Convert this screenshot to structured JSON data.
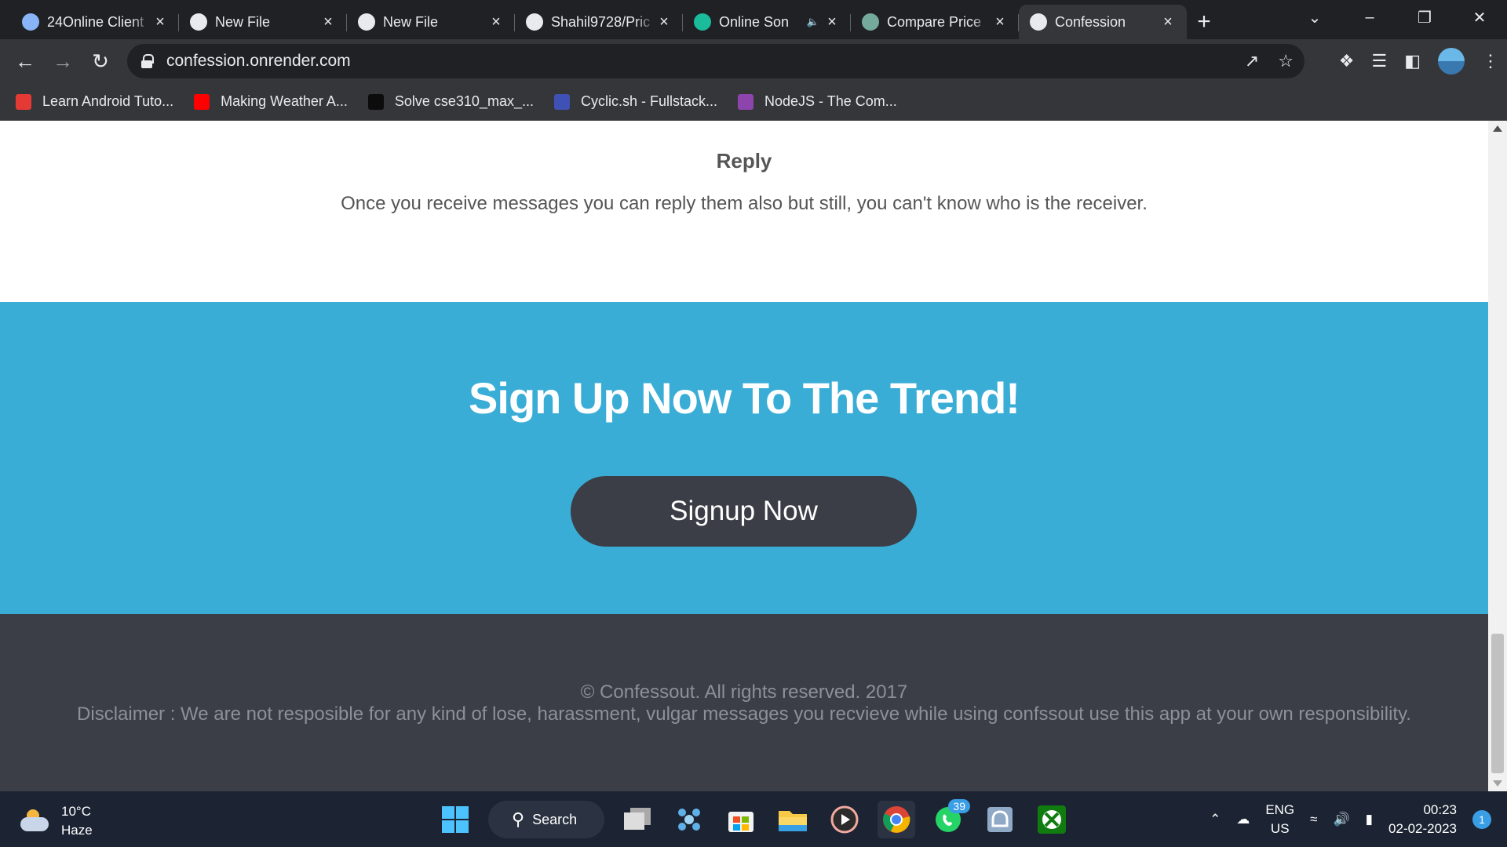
{
  "browser": {
    "tabs": [
      {
        "title": "24Online Client",
        "icon": "cloud-icon",
        "color": "#8ab4f8"
      },
      {
        "title": "New File",
        "icon": "github-icon",
        "color": "#e8eaed"
      },
      {
        "title": "New File",
        "icon": "github-icon",
        "color": "#e8eaed"
      },
      {
        "title": "Shahil9728/Pric",
        "icon": "github-icon",
        "color": "#e8eaed"
      },
      {
        "title": "Online Son",
        "icon": "online-icon",
        "color": "#1abc9c"
      },
      {
        "title": "Compare Price",
        "icon": "chatgpt-icon",
        "color": "#74aa9c"
      },
      {
        "title": "Confession",
        "icon": "page-icon",
        "color": "#e8eaed",
        "active": true
      }
    ],
    "url": "confession.onrender.com",
    "bookmarks": [
      {
        "label": "Learn Android Tuto...",
        "color": "#e53935",
        "icon": "learn-android-icon"
      },
      {
        "label": "Making Weather A...",
        "color": "#ff0000",
        "icon": "youtube-icon"
      },
      {
        "label": "Solve cse310_max_...",
        "color": "#0c0c0c",
        "icon": "hackerearth-icon"
      },
      {
        "label": "Cyclic.sh - Fullstack...",
        "color": "#3f51b5",
        "icon": "cyclic-icon"
      },
      {
        "label": "NodeJS - The Com...",
        "color": "#8e44ad",
        "icon": "udemy-icon"
      }
    ]
  },
  "page": {
    "reply_title": "Reply",
    "reply_text": "Once you receive messages you can reply them also but still, you can't know who is the receiver.",
    "signup_heading": "Sign Up Now To The Trend!",
    "signup_button": "Signup Now",
    "footer_copyright": "© Confessout. All rights reserved. 2017",
    "footer_disclaimer": "Disclaimer : We are not resposible for any kind of lose, harassment, vulgar messages you recvieve while using confssout use this app at your own responsibility.",
    "colors": {
      "signup_bg": "#3aadd7",
      "footer_bg": "#3b3e46",
      "button_bg": "#3b3e46"
    }
  },
  "taskbar": {
    "temperature": "10°C",
    "weather": "Haze",
    "search_label": "Search",
    "whatsapp_badge": "39",
    "lang_top": "ENG",
    "lang_bottom": "US",
    "time": "00:23",
    "date": "02-02-2023",
    "notification_count": "1"
  }
}
